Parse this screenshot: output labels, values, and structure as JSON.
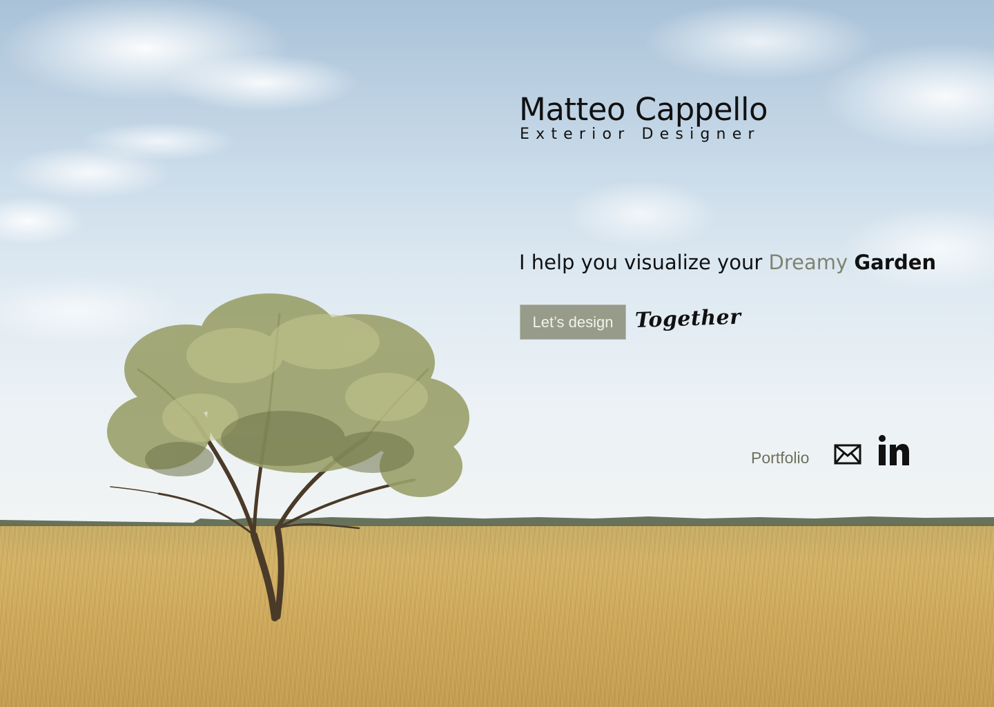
{
  "header": {
    "name": "Matteo Cappello",
    "role": "Exterior Designer"
  },
  "tagline": {
    "lead": "I help you visualize your ",
    "accent": "Dreamy",
    "strong": "Garden"
  },
  "cta": {
    "button_label": "Let’s design",
    "script_word": "Together"
  },
  "links": {
    "portfolio_label": "Portfolio",
    "mail_icon": "mail-icon",
    "linkedin_icon": "linkedin-icon"
  },
  "colors": {
    "accent": "#7f836f",
    "button_bg": "#979b89",
    "text": "#111111"
  }
}
